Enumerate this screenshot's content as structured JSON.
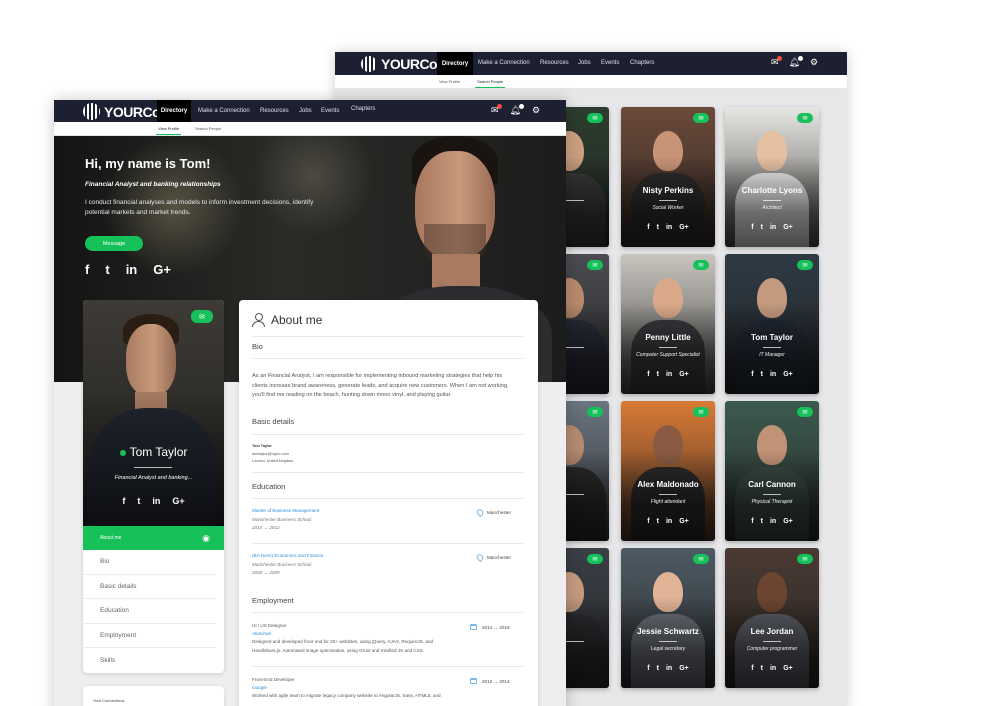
{
  "brand": {
    "name": "YOURCo"
  },
  "nav": {
    "items": [
      "Directory",
      "Make a Connection",
      "Resources",
      "Jobs",
      "Events",
      "Chapters"
    ],
    "icons": [
      "mail-icon",
      "bell-icon",
      "gear-icon"
    ]
  },
  "subnav_back": {
    "items": [
      "View Profile",
      "Search People"
    ],
    "active": "Search People"
  },
  "subnav_front": {
    "items": [
      "View Profile",
      "Search People"
    ],
    "active": "View Profile"
  },
  "hero": {
    "title": "Hi, my name is Tom!",
    "subtitle": "Financial Analyst and banking relationships",
    "description": "I conduct financial analyses and models to inform investment decisions, identify potential markets and market trends.",
    "button": "Message",
    "social": [
      "f",
      "t",
      "in",
      "G+"
    ]
  },
  "profile": {
    "name": "Tom Taylor",
    "role": "Financial Analyst and banking...",
    "social": [
      "f",
      "t",
      "in",
      "G+"
    ],
    "menu": [
      "About me",
      "Bio",
      "Basic details",
      "Education",
      "Employment",
      "Skills"
    ]
  },
  "connections": {
    "label": "Your Connections"
  },
  "about": {
    "title": "About me",
    "bio_label": "Bio",
    "bio": "As an Financial Analyst, I am responsible for implementing inbound marketing strategies that help his clients increase brand awareness, generate leads, and acquire new customers. When I am not working, you'll find me reading on the beach, hunting down mono vinyl, and playing guitar.",
    "basic_label": "Basic details",
    "basic": {
      "name": "Tom Taylor",
      "email": "tomtaylor@myco.com",
      "location": "London, United kingdom"
    },
    "education_label": "Education",
    "education": [
      {
        "degree": "Master of Business Management",
        "school": "Manchester Business School",
        "years": "2010 → 2012",
        "location": "Manchester"
      },
      {
        "degree": "(BA Hons) Economics and Finance",
        "school": "Manchester Business School",
        "years": "2008 → 2009",
        "location": "Manchester"
      }
    ],
    "employment_label": "Employment",
    "employment": [
      {
        "title": "UI / UX Designer",
        "company": "Aluminati",
        "desc": "Designed and developed front end for 20+ websites, using jQuery, AJAX, RequireJS, and Handlebars.js. Automated image optimisation, using Grunt and minified JS and CSS.",
        "dates": "2014 → 2019"
      },
      {
        "title": "Front-End Developer",
        "company": "Google",
        "desc": "Worked with agile team to migrate legacy company website to AngularJS, Sass, HTML5, and",
        "dates": "2012 → 2014"
      }
    ]
  },
  "directory": [
    {
      "name": "...urns",
      "role": "...inistrator",
      "social": [
        "in",
        "G+"
      ]
    },
    {
      "name": "Nisty Perkins",
      "role": "Social Worker",
      "social": [
        "f",
        "t",
        "in",
        "G+"
      ]
    },
    {
      "name": "Charlotte Lyons",
      "role": "Architect",
      "social": [
        "f",
        "t",
        "in",
        "G+"
      ]
    },
    {
      "name": "...n Diaz",
      "role": "...dvisor",
      "social": [
        "in",
        "G+"
      ]
    },
    {
      "name": "Penny Little",
      "role": "Computer Support Specialist",
      "social": [
        "f",
        "t",
        "in",
        "G+"
      ]
    },
    {
      "name": "Tom Taylor",
      "role": "IT Manager",
      "social": [
        "f",
        "t",
        "in",
        "G+"
      ]
    },
    {
      "name": "Neal",
      "role": "...gist",
      "social": [
        "in",
        "G+"
      ]
    },
    {
      "name": "Alex Maldonado",
      "role": "Flight attendant",
      "social": [
        "f",
        "t",
        "in",
        "G+"
      ]
    },
    {
      "name": "Carl Cannon",
      "role": "Physical Therapist",
      "social": [
        "f",
        "t",
        "in",
        "G+"
      ]
    },
    {
      "name": "...aylor",
      "role": "...dvisor",
      "social": [
        "in",
        "G+"
      ]
    },
    {
      "name": "Jessie Schwartz",
      "role": "Legal secretary",
      "social": [
        "f",
        "t",
        "in",
        "G+"
      ]
    },
    {
      "name": "Lee Jordan",
      "role": "Computer programmer",
      "social": [
        "f",
        "t",
        "in",
        "G+"
      ]
    }
  ],
  "colors": {
    "accent": "#16c15a",
    "nav": "#1d2030",
    "link": "#2a8fe0",
    "notify": "#ff4b3e"
  }
}
